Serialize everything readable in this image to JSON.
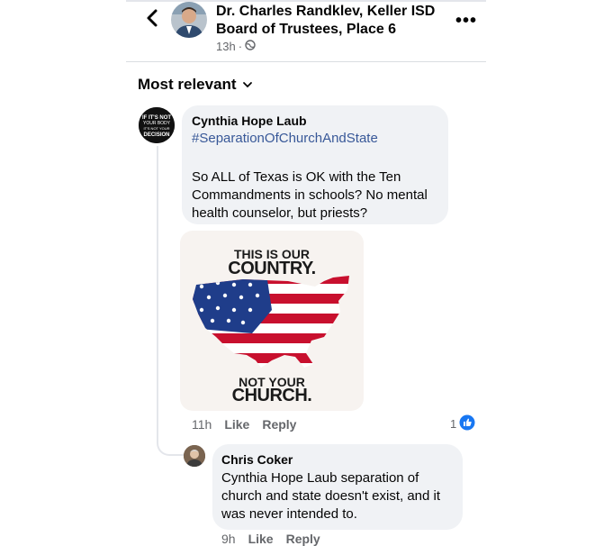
{
  "header": {
    "author_line1": "Dr. Charles Randklev, Keller ISD",
    "author_line2": "Board of Trustees, Place 6",
    "time": "13h",
    "more_label": "•••"
  },
  "sort": {
    "label": "Most relevant"
  },
  "comments": [
    {
      "name": "Cynthia Hope Laub",
      "hashtag": "#SeparationOfChurchAndState",
      "text_lines": [
        "So ALL of Texas is OK with the Ten",
        "Commandments in schools? No mental",
        "health counselor, but priests?"
      ],
      "avatar_text": "IF IT'S NOT YOUR BODY IT'S NOT YOUR DECISION",
      "image": {
        "top_line1": "THIS IS OUR",
        "top_line2": "COUNTRY.",
        "bottom_line1": "NOT YOUR",
        "bottom_line2": "CHURCH."
      },
      "time": "11h",
      "like": "Like",
      "reply": "Reply",
      "reaction_count": "1",
      "reaction_color": "#1877f2"
    },
    {
      "name": "Chris Coker",
      "text_lines": [
        "Cynthia Hope Laub separation of",
        "church and state doesn't exist, and it",
        "was never intended to."
      ],
      "time": "9h",
      "like": "Like",
      "reply": "Reply"
    }
  ],
  "colors": {
    "bubble": "#f0f2f5",
    "meta": "#65676b",
    "hashtag": "#385898"
  }
}
